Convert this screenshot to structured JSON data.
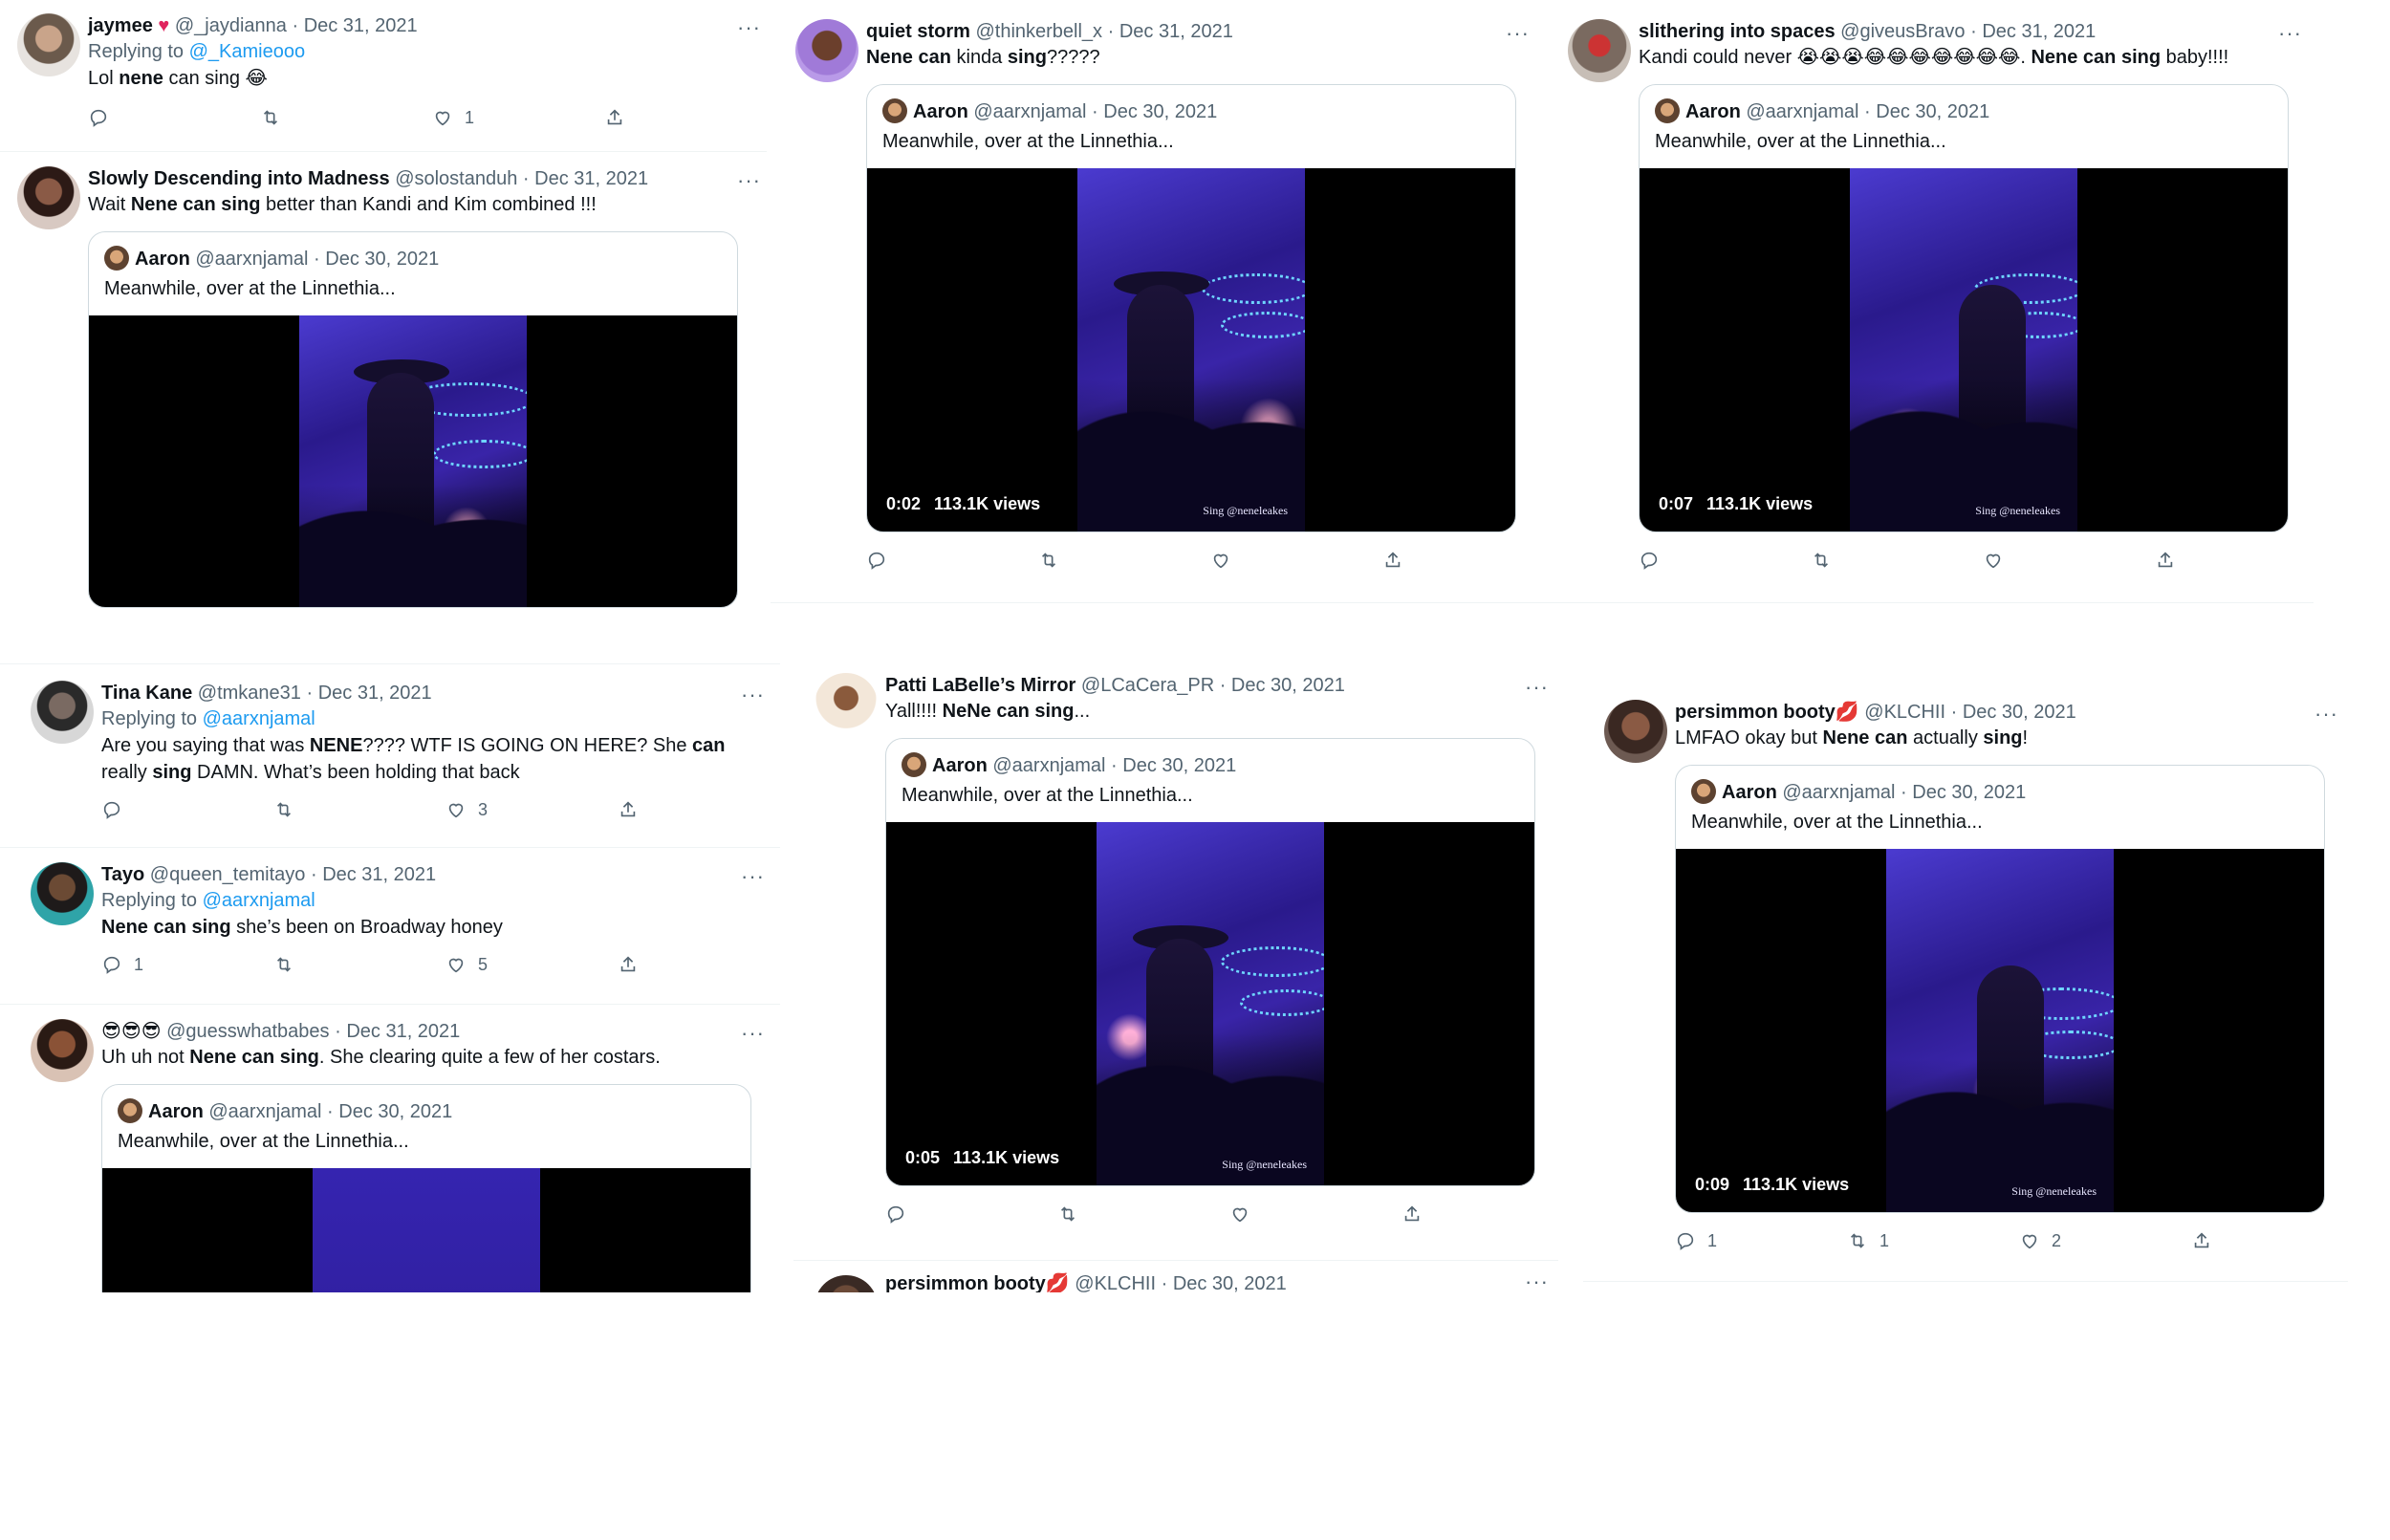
{
  "tweets": {
    "t1": {
      "name": "jaymee",
      "handle": "@_jaydianna",
      "date": "Dec 31, 2021",
      "replying": "Replying to",
      "replying_to": "@_Kamieooo",
      "text_pre": "Lol ",
      "text_b1": "nene",
      "text_mid": " can sing 😂",
      "replies": "",
      "retweets": "",
      "likes": "1"
    },
    "t2": {
      "name": "Slowly Descending into Madness",
      "handle": "@solostanduh",
      "date": "Dec 31, 2021",
      "text_pre": "Wait ",
      "text_b1": "Nene can sing",
      "text_mid": " better than Kandi and Kim combined !!!",
      "quote": {
        "name": "Aaron",
        "handle": "@aarxnjamal",
        "date": "Dec 30, 2021",
        "text": "Meanwhile, over at the Linnethia..."
      }
    },
    "t3": {
      "name": "quiet storm",
      "handle": "@thinkerbell_x",
      "date": "Dec 31, 2021",
      "text_b1": "Nene can",
      "text_mid": " kinda ",
      "text_b2": "sing",
      "text_post": "?????",
      "quote": {
        "name": "Aaron",
        "handle": "@aarxnjamal",
        "date": "Dec 30, 2021",
        "text": "Meanwhile, over at the Linnethia...",
        "time": "0:02",
        "views": "113.1K views",
        "watermark": "Sing @neneleakes"
      }
    },
    "t4": {
      "name": "slithering into spaces",
      "handle": "@giveusBravo",
      "date": "Dec 31, 2021",
      "text_pre": "Kandi could never 😭😭😭😂😂😂😂😂😂😂. ",
      "text_b1": "Nene can sing",
      "text_mid": " baby!!!!",
      "quote": {
        "name": "Aaron",
        "handle": "@aarxnjamal",
        "date": "Dec 30, 2021",
        "text": "Meanwhile, over at the Linnethia...",
        "time": "0:07",
        "views": "113.1K views",
        "watermark": "Sing @neneleakes"
      }
    },
    "t5": {
      "name": "Tina Kane",
      "handle": "@tmkane31",
      "date": "Dec 31, 2021",
      "replying": "Replying to",
      "replying_to": "@aarxnjamal",
      "text_pre": "Are you saying that was ",
      "text_b1": "NENE",
      "text_mid": "???? WTF IS GOING ON HERE? She ",
      "text_b2": "can",
      "text_line2_pre": "really ",
      "text_line2_b": "sing",
      "text_line2_post": " DAMN. What’s been holding that back",
      "replies": "",
      "retweets": "",
      "likes": "3"
    },
    "t6": {
      "name": "Tayo",
      "handle": "@queen_temitayo",
      "date": "Dec 31, 2021",
      "replying": "Replying to",
      "replying_to": "@aarxnjamal",
      "text_b1": "Nene can sing",
      "text_mid": " she’s been on Broadway honey",
      "replies": "1",
      "retweets": "",
      "likes": "5"
    },
    "t7": {
      "name": "😎😎😎",
      "handle": "@guesswhatbabes",
      "date": "Dec 31, 2021",
      "text_pre": "Uh uh not ",
      "text_b1": "Nene can sing",
      "text_mid": ". She clearing quite a few of her costars.",
      "quote": {
        "name": "Aaron",
        "handle": "@aarxnjamal",
        "date": "Dec 30, 2021",
        "text": "Meanwhile, over at the Linnethia..."
      }
    },
    "t8": {
      "name": "Patti LaBelle’s Mirror",
      "handle": "@LCaCera_PR",
      "date": "Dec 30, 2021",
      "text_pre": "Yall!!!! ",
      "text_b1": "NeNe can sing",
      "text_mid": "...",
      "quote": {
        "name": "Aaron",
        "handle": "@aarxnjamal",
        "date": "Dec 30, 2021",
        "text": "Meanwhile, over at the Linnethia...",
        "time": "0:05",
        "views": "113.1K views",
        "watermark": "Sing @neneleakes"
      }
    },
    "t9": {
      "name": "persimmon booty💋",
      "handle": "@KLCHII",
      "date": "Dec 30, 2021"
    },
    "t10": {
      "name": "persimmon booty💋",
      "handle": "@KLCHII",
      "date": "Dec 30, 2021",
      "text_pre": "LMFAO okay but ",
      "text_b1": "Nene can",
      "text_mid": " actually ",
      "text_b2": "sing",
      "text_post": "!",
      "quote": {
        "name": "Aaron",
        "handle": "@aarxnjamal",
        "date": "Dec 30, 2021",
        "text": "Meanwhile, over at the Linnethia...",
        "time": "0:09",
        "views": "113.1K views",
        "watermark": "Sing @neneleakes"
      },
      "replies": "1",
      "retweets": "1",
      "likes": "2"
    }
  },
  "ui": {
    "dot": " · ",
    "more": "···"
  },
  "colors": {
    "link": "#1d9bf0",
    "muted": "#536471",
    "border": "#cfd9de"
  }
}
